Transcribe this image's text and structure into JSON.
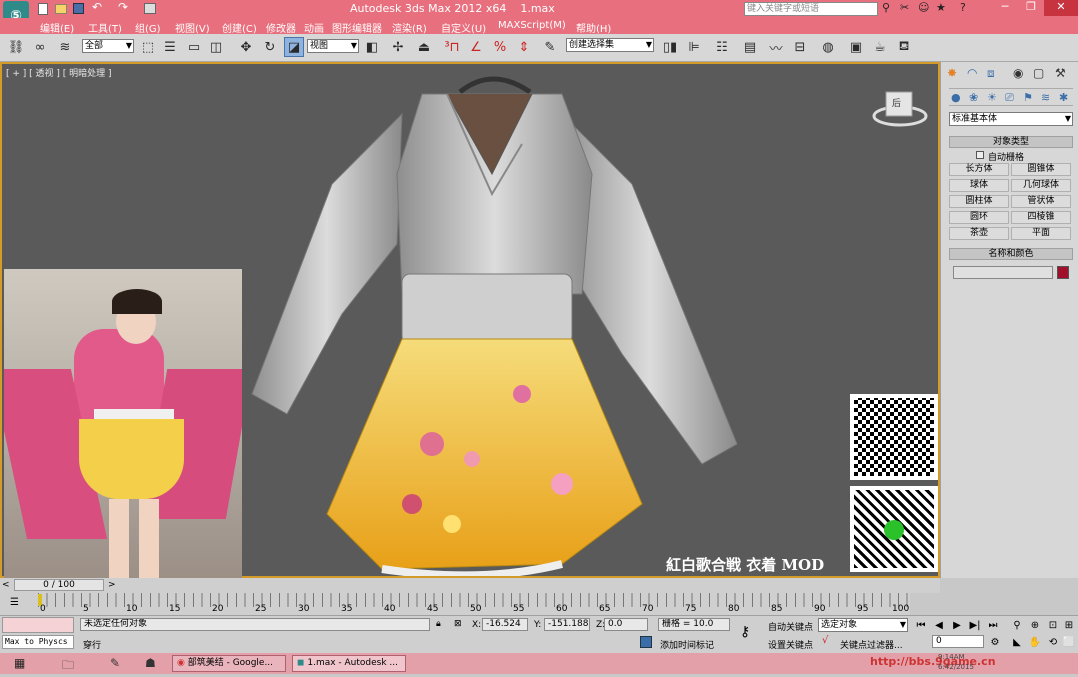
{
  "title": {
    "app": "Autodesk 3ds Max  2012 x64",
    "file": "1.max",
    "search_placeholder": "键入关键字或短语"
  },
  "menu": [
    "编辑(E)",
    "工具(T)",
    "组(G)",
    "视图(V)",
    "创建(C)",
    "修改器",
    "动画",
    "图形编辑器",
    "渲染(R)",
    "自定义(U)",
    "MAXScript(M)",
    "帮助(H)"
  ],
  "toolbar": {
    "filter": "全部",
    "view": "视图",
    "named_selection": "创建选择集"
  },
  "viewport": {
    "label": "[ + ] [ 透视 ] [ 明暗处理 ]",
    "cube_label": "后",
    "mod_caption": "紅白歌合戦 衣着 MOD"
  },
  "panel": {
    "category": "标准基本体",
    "object_type_header": "对象类型",
    "autogrid": "自动栅格",
    "buttons": [
      "长方体",
      "圆锥体",
      "球体",
      "几何球体",
      "圆柱体",
      "管状体",
      "圆环",
      "四棱锥",
      "茶壶",
      "平面"
    ],
    "name_color_header": "名称和颜色",
    "object_color": "#a0102a"
  },
  "time": {
    "slider": "0 / 100",
    "ticks": [
      "0",
      "5",
      "10",
      "15",
      "20",
      "25",
      "30",
      "35",
      "40",
      "45",
      "50",
      "55",
      "60",
      "65",
      "70",
      "75",
      "80",
      "85",
      "90",
      "95",
      "100"
    ]
  },
  "status": {
    "maxscript": "Max to Physcs (",
    "selection": "未选定任何对象",
    "prompt": "穿行",
    "x_label": "X:",
    "x": "-16.524",
    "y_label": "Y:",
    "y": "-151.188",
    "z_label": "Z:",
    "z": "0.0",
    "grid": "栅格 = 10.0",
    "add_time_tag": "添加时间标记",
    "auto_key": "自动关键点",
    "set_key": "设置关键点",
    "key_mode": "选定对象",
    "key_filters": "关键点过滤器...",
    "frame": "0"
  },
  "taskbar": {
    "items": [
      "部筑美结 - Google...",
      "1.max - Autodesk ..."
    ],
    "url": "http://bbs.9game.cn",
    "clock1": "9:14AM",
    "clock2": "6:42/2015"
  },
  "colors": {
    "title": "#e8707e",
    "viewport_bg": "#5a5a5a",
    "active_border": "#d59b28",
    "skirt": "#f2b830"
  }
}
